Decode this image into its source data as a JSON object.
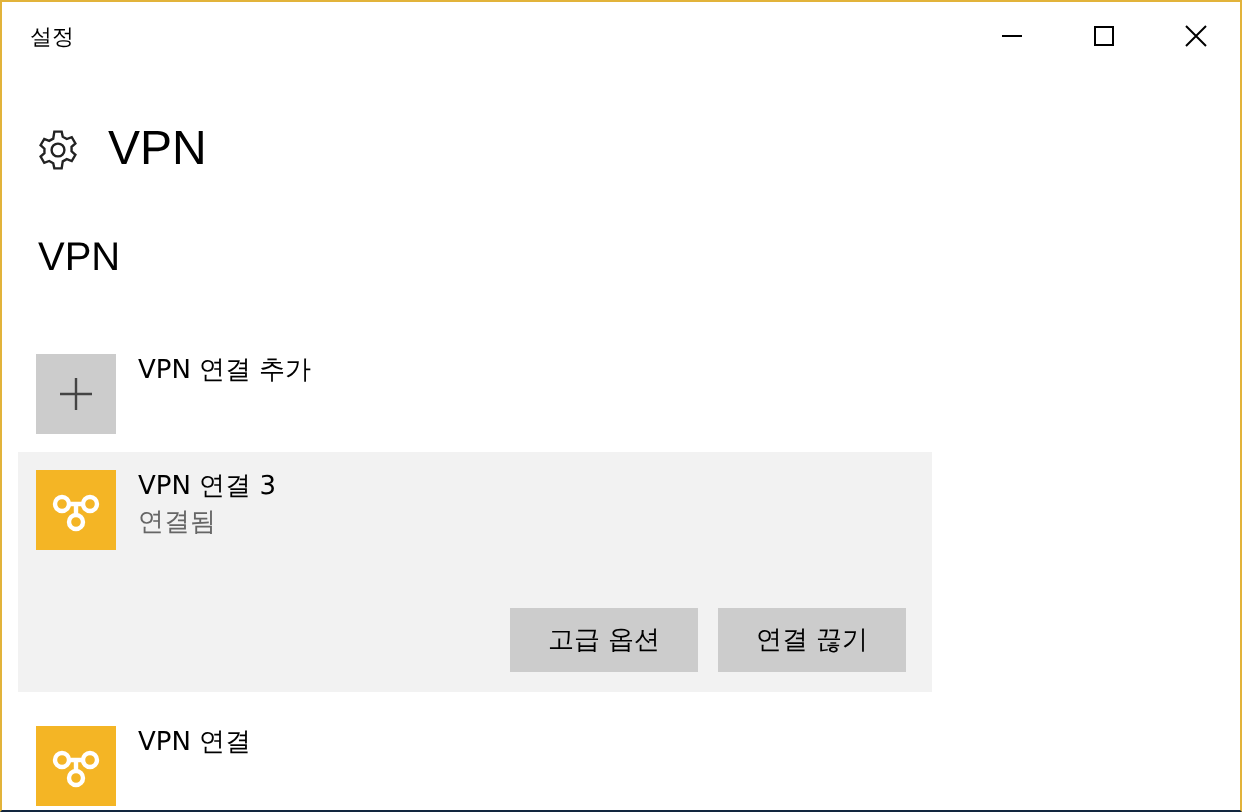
{
  "window": {
    "title": "설정"
  },
  "header": {
    "title": "VPN"
  },
  "section": {
    "title": "VPN"
  },
  "add_item": {
    "label": "VPN 연결 추가"
  },
  "connections": [
    {
      "name": "VPN 연결 3",
      "status": "연결됨",
      "selected": true,
      "buttons": [
        "고급 옵션",
        "연결 끊기"
      ]
    },
    {
      "name": "VPN 연결",
      "selected": false
    }
  ]
}
